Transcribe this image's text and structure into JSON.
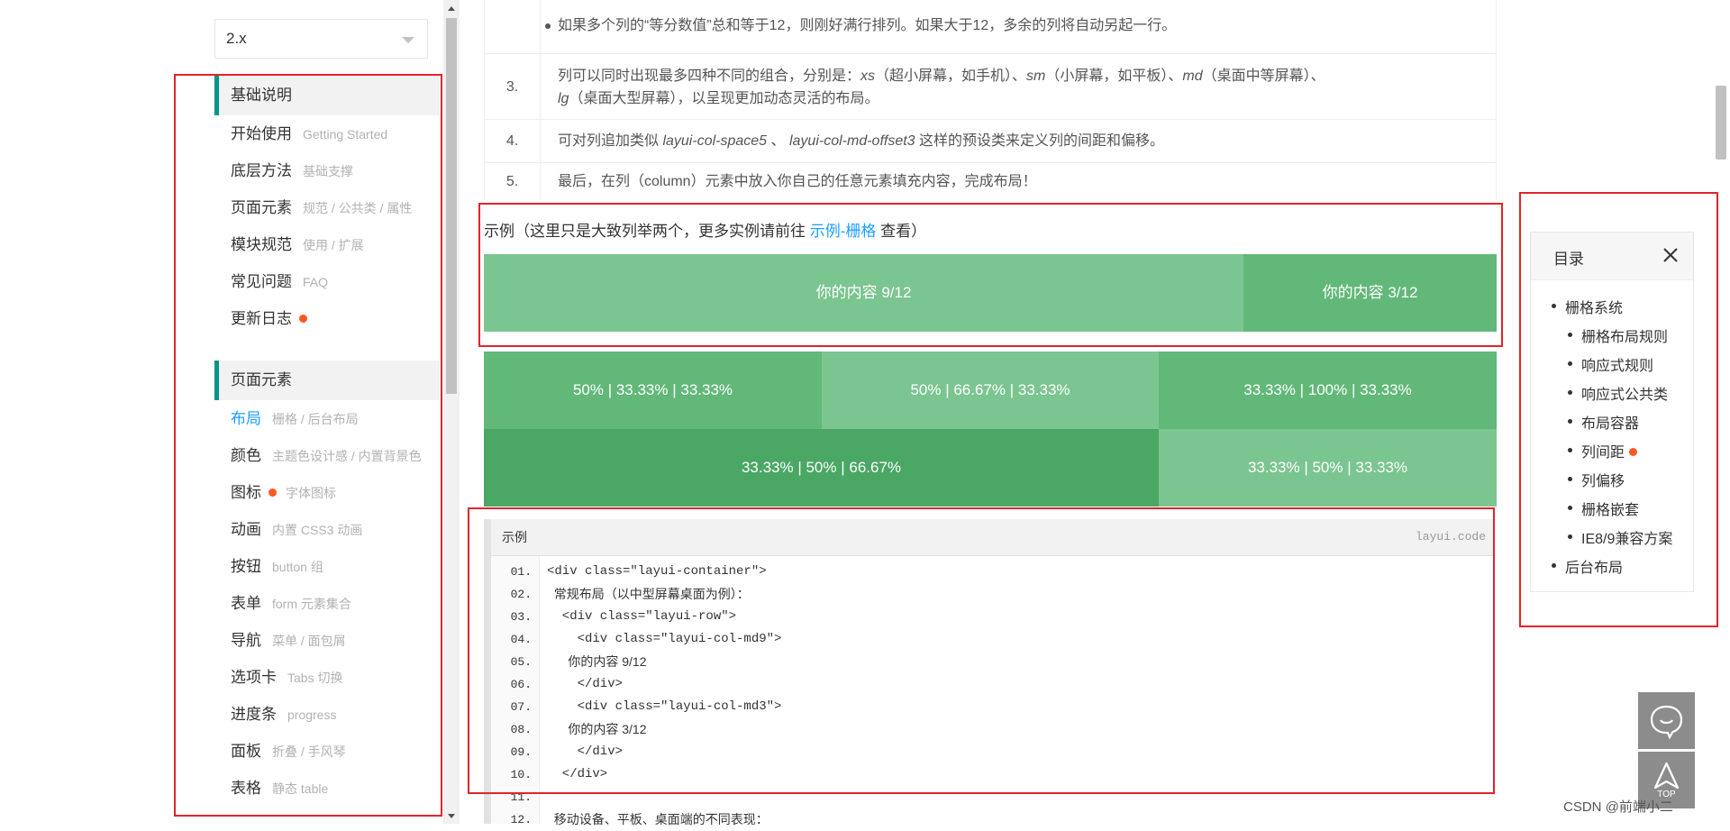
{
  "sidebar": {
    "version": "2.x",
    "groups": [
      {
        "header": "基础说明",
        "items": [
          {
            "label": "开始使用",
            "sub": "Getting Started"
          },
          {
            "label": "底层方法",
            "sub": "基础支撑"
          },
          {
            "label": "页面元素",
            "sub": "规范 / 公共类 / 属性"
          },
          {
            "label": "模块规范",
            "sub": "使用 / 扩展"
          },
          {
            "label": "常见问题",
            "sub": "FAQ"
          },
          {
            "label": "更新日志",
            "sub": ""
          }
        ]
      },
      {
        "header": "页面元素",
        "items": [
          {
            "label": "布局",
            "sub": "栅格 / 后台布局"
          },
          {
            "label": "颜色",
            "sub": "主题色设计感 / 内置背景色"
          },
          {
            "label": "图标",
            "sub": "字体图标"
          },
          {
            "label": "动画",
            "sub": "内置 CSS3 动画"
          },
          {
            "label": "按钮",
            "sub": "button 组"
          },
          {
            "label": "表单",
            "sub": "form 元素集合"
          },
          {
            "label": "导航",
            "sub": "菜单 / 面包屑"
          },
          {
            "label": "选项卡",
            "sub": "Tabs 切换"
          },
          {
            "label": "进度条",
            "sub": "progress"
          },
          {
            "label": "面板",
            "sub": "折叠 / 手风琴"
          },
          {
            "label": "表格",
            "sub": "静态 table"
          }
        ]
      }
    ]
  },
  "content": {
    "list": {
      "top_line": "如果多个列的“等分数值”总和等于12，则刚好满行排列。如果大于12，多余的列将自动另起一行。",
      "rows": [
        {
          "num": "3.",
          "line1_a": "列可以同时出现最多四种不同的组合，分别是：",
          "xs": "xs",
          "xs_note": "（超小屏幕，如手机）、",
          "sm": "sm",
          "sm_note": "（小屏幕，如平板）、",
          "md": "md",
          "md_note": "（桌面中等屏幕）、",
          "lg": "lg",
          "line2": "（桌面大型屏幕），以呈现更加动态灵活的布局。"
        },
        {
          "num": "4.",
          "a": "可对列追加类似 ",
          "class1": "layui-col-space5",
          "b": " 、 ",
          "class2": "layui-col-md-offset3",
          "c": " 这样的预设类来定义列的间距和偏移。"
        },
        {
          "num": "5.",
          "text": "最后，在列（column）元素中放入你自己的任意元素填充内容，完成布局！"
        }
      ]
    },
    "example": {
      "prefix": "示例（这里只是大致列举两个，更多实例请前往 ",
      "link": "示例-栅格",
      "suffix": " 查看）"
    },
    "grid_demo": {
      "row1": [
        "你的内容 9/12",
        "你的内容 3/12"
      ],
      "row2": [
        "50% | 33.33% | 33.33%",
        "50% | 66.67% | 33.33%",
        "33.33% | 100% | 33.33%"
      ],
      "row3": [
        "33.33% | 50% | 66.67%",
        "33.33% | 50% | 33.33%"
      ],
      "colors": {
        "light": "#7bc590",
        "mid": "#62b878",
        "dark": "#4aa764"
      }
    },
    "code": {
      "title": "示例",
      "brand": "layui.code",
      "lines": [
        {
          "n": "01.",
          "t": "<div class=\"layui-container\">"
        },
        {
          "n": "02.",
          "t": "  常规布局（以中型屏幕桌面为例）："
        },
        {
          "n": "03.",
          "t": "  <div class=\"layui-row\">"
        },
        {
          "n": "04.",
          "t": "    <div class=\"layui-col-md9\">"
        },
        {
          "n": "05.",
          "t": "      你的内容 9/12"
        },
        {
          "n": "06.",
          "t": "    </div>"
        },
        {
          "n": "07.",
          "t": "    <div class=\"layui-col-md3\">"
        },
        {
          "n": "08.",
          "t": "      你的内容 3/12"
        },
        {
          "n": "09.",
          "t": "    </div>"
        },
        {
          "n": "10.",
          "t": "  </div>"
        },
        {
          "n": "11.",
          "t": ""
        },
        {
          "n": "12.",
          "t": "  移动设备、平板、桌面端的不同表现："
        }
      ]
    }
  },
  "toc": {
    "title": "目录",
    "items": [
      {
        "label": "栅格系统",
        "level": 1
      },
      {
        "label": "栅格布局规则",
        "level": 2
      },
      {
        "label": "响应式规则",
        "level": 2
      },
      {
        "label": "响应式公共类",
        "level": 2
      },
      {
        "label": "布局容器",
        "level": 2
      },
      {
        "label": "列间距",
        "level": 2
      },
      {
        "label": "列偏移",
        "level": 2
      },
      {
        "label": "栅格嵌套",
        "level": 2
      },
      {
        "label": "IE8/9兼容方案",
        "level": 2
      },
      {
        "label": "后台布局",
        "level": 1
      }
    ]
  },
  "float": {
    "top_label": "TOP"
  },
  "watermark": "CSDN @前端小二",
  "theme": {
    "accent": "#009688",
    "link": "#1e9fff",
    "dot": "#ff5722",
    "annotation": "#e0242b"
  }
}
